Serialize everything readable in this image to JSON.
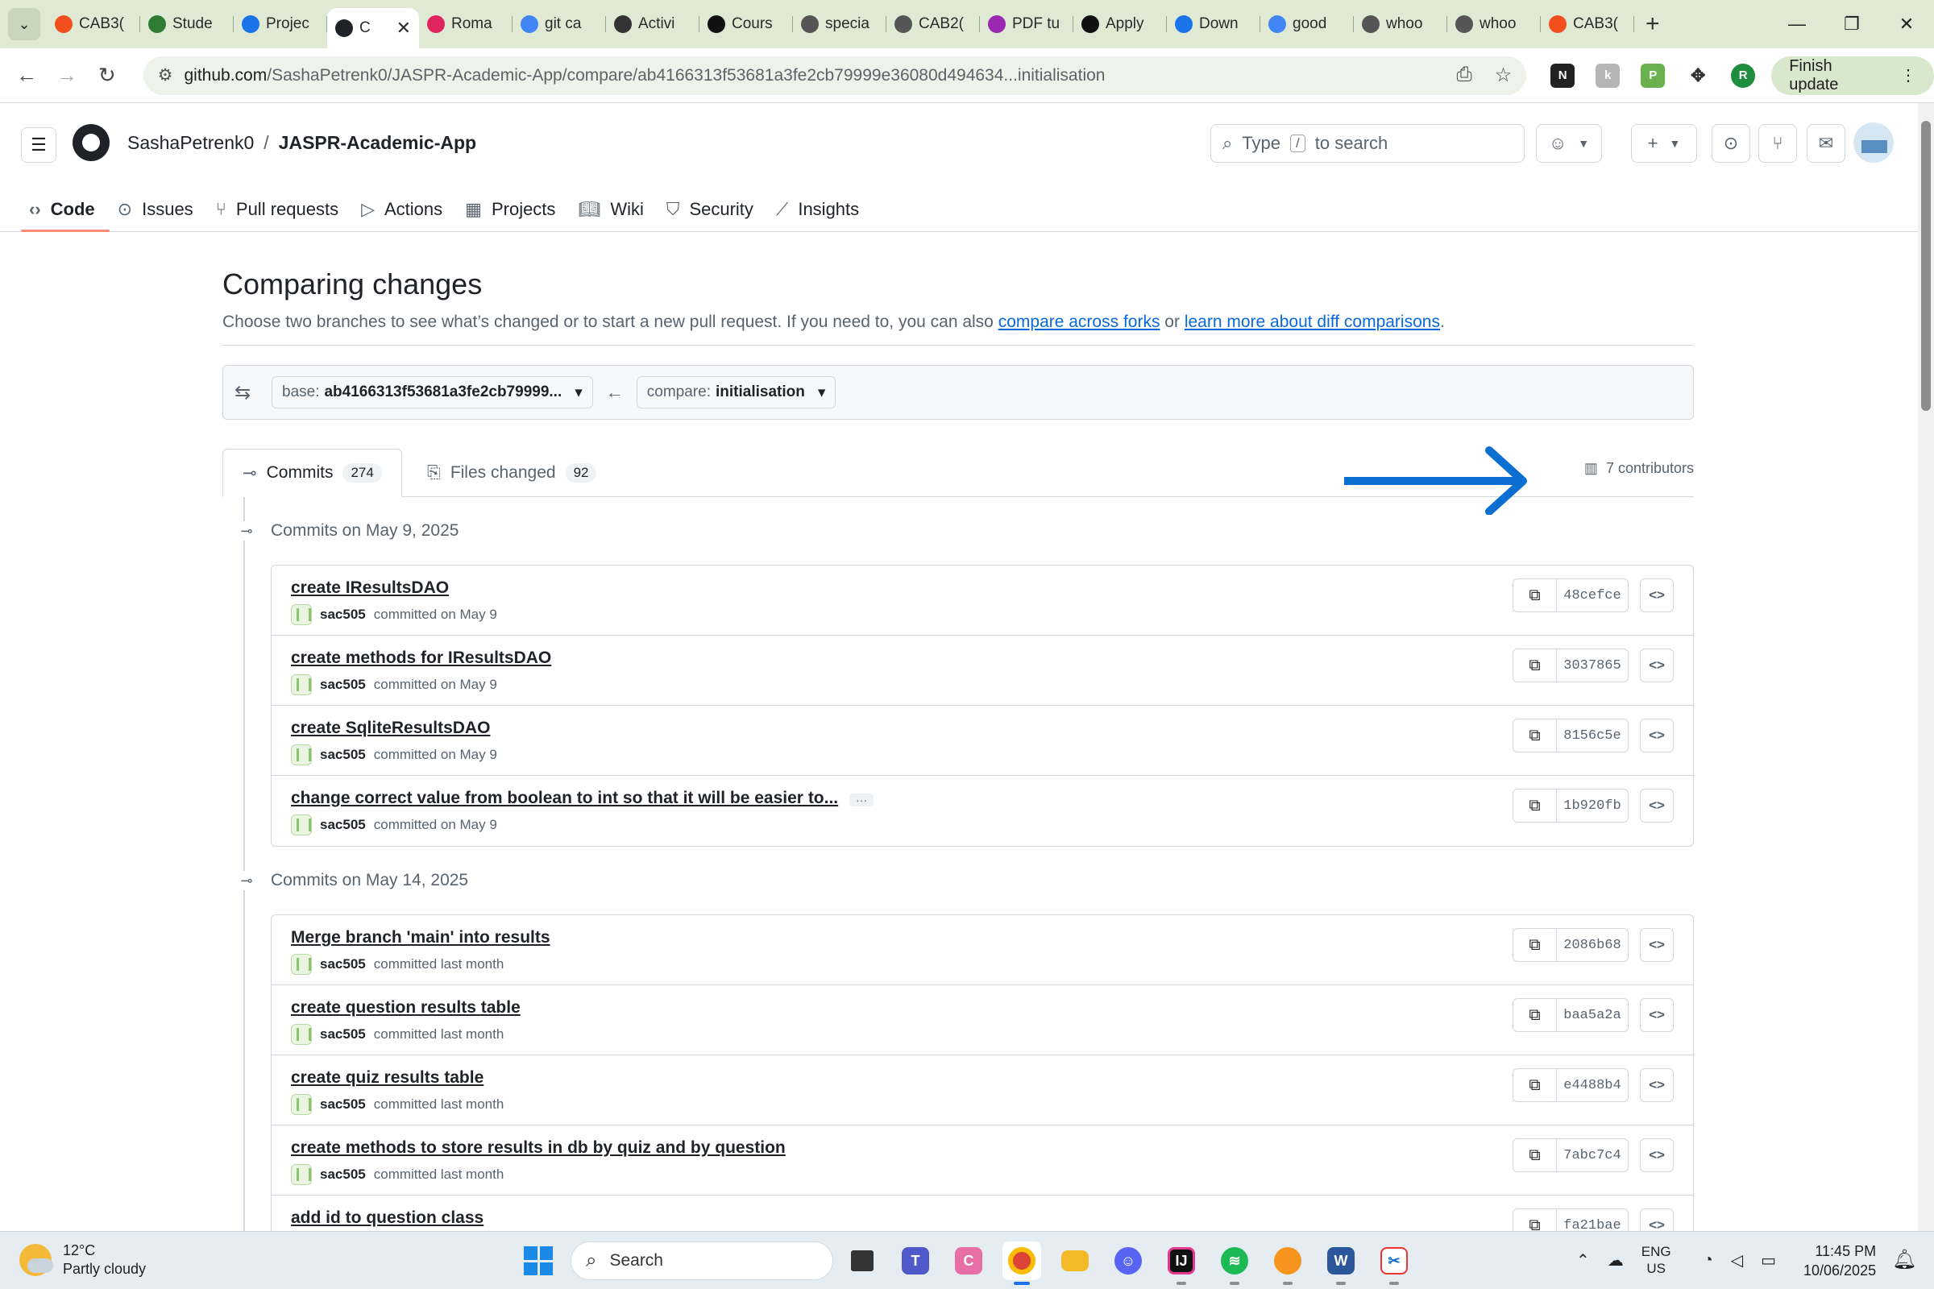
{
  "browser": {
    "tabs": [
      {
        "label": "CAB3(",
        "icon": "figma-icon",
        "color": "#f24e1e"
      },
      {
        "label": "Stude",
        "icon": "lock-icon",
        "color": "#2e7d32"
      },
      {
        "label": "Projec",
        "icon": "search-icon",
        "color": "#1a73e8"
      },
      {
        "label": "C",
        "icon": "github-icon",
        "color": "#1f2328",
        "active": true
      },
      {
        "label": "Roma",
        "icon": "app-icon",
        "color": "#e0245e"
      },
      {
        "label": "git ca",
        "icon": "google-icon",
        "color": "#4285f4"
      },
      {
        "label": "Activi",
        "icon": "qut-icon",
        "color": "#333333"
      },
      {
        "label": "Cours",
        "icon": "qut-icon",
        "color": "#111111"
      },
      {
        "label": "specia",
        "icon": "github-icon",
        "color": "#555555"
      },
      {
        "label": "CAB2(",
        "icon": "github-icon",
        "color": "#555555"
      },
      {
        "label": "PDF tu",
        "icon": "pdf-icon",
        "color": "#9c27b0"
      },
      {
        "label": "Apply",
        "icon": "openai-icon",
        "color": "#111111"
      },
      {
        "label": "Down",
        "icon": "download-icon",
        "color": "#1a73e8"
      },
      {
        "label": "good",
        "icon": "google-icon",
        "color": "#4285f4"
      },
      {
        "label": "whoo",
        "icon": "github-icon",
        "color": "#555555"
      },
      {
        "label": "whoo",
        "icon": "github-icon",
        "color": "#555555"
      },
      {
        "label": "CAB3(",
        "icon": "figma-icon",
        "color": "#f24e1e"
      }
    ],
    "url_host": "github.com",
    "url_path": "/SashaPetrenk0/JASPR-Academic-App/compare/ab4166313f53681a3fe2cb79999e36080d494634...initialisation",
    "finish_update": "Finish update",
    "profile_initial": "R"
  },
  "github": {
    "owner": "SashaPetrenk0",
    "separator": "/",
    "repo": "JASPR-Academic-App",
    "search_prefix": "Type",
    "search_key": "/",
    "search_suffix": "to search",
    "nav": [
      {
        "label": "Code",
        "icon": "code-icon",
        "selected": true
      },
      {
        "label": "Issues",
        "icon": "issue-icon"
      },
      {
        "label": "Pull requests",
        "icon": "pull-request-icon"
      },
      {
        "label": "Actions",
        "icon": "play-icon"
      },
      {
        "label": "Projects",
        "icon": "table-icon"
      },
      {
        "label": "Wiki",
        "icon": "book-icon"
      },
      {
        "label": "Security",
        "icon": "shield-icon"
      },
      {
        "label": "Insights",
        "icon": "graph-icon"
      }
    ]
  },
  "compare": {
    "title": "Comparing changes",
    "desc_prefix": "Choose two branches to see what’s changed or to start a new pull request. If you need to, you can also",
    "link1": "compare across forks",
    "desc_mid": "or",
    "link2": "learn more about diff comparisons",
    "desc_end": ".",
    "base_label": "base:",
    "base_value": "ab4166313f53681a3fe2cb79999...",
    "compare_label": "compare:",
    "compare_value": "initialisation",
    "commits_tab": "Commits",
    "commits_count": "274",
    "files_tab": "Files changed",
    "files_count": "92",
    "contributors": "7 contributors"
  },
  "commit_groups": [
    {
      "date": "Commits on May 9, 2025",
      "commits": [
        {
          "title": "create IResultsDAO",
          "author": "sac505",
          "when": "committed on May 9",
          "sha": "48cefce"
        },
        {
          "title": "create methods for IResultsDAO",
          "author": "sac505",
          "when": "committed on May 9",
          "sha": "3037865"
        },
        {
          "title": "create SqliteResultsDAO",
          "author": "sac505",
          "when": "committed on May 9",
          "sha": "8156c5e"
        },
        {
          "title": "change correct value from boolean to int so that it will be easier to...",
          "author": "sac505",
          "when": "committed on May 9",
          "sha": "1b920fb",
          "ellipsis": "···"
        }
      ]
    },
    {
      "date": "Commits on May 14, 2025",
      "commits": [
        {
          "title": "Merge branch 'main' into results",
          "author": "sac505",
          "when": "committed last month",
          "sha": "2086b68"
        },
        {
          "title": "create question results table",
          "author": "sac505",
          "when": "committed last month",
          "sha": "baa5a2a"
        },
        {
          "title": "create quiz results table",
          "author": "sac505",
          "when": "committed last month",
          "sha": "e4488b4"
        },
        {
          "title": "create methods to store results in db by quiz and by question",
          "author": "sac505",
          "when": "committed last month",
          "sha": "7abc7c4"
        },
        {
          "title": "add id to question class",
          "author": "sac505",
          "when": "committed last month",
          "sha": "fa21bae"
        }
      ]
    }
  ],
  "taskbar": {
    "temp": "12°C",
    "weather": "Partly cloudy",
    "search": "Search",
    "lang1": "ENG",
    "lang2": "US",
    "time": "11:45 PM",
    "date": "10/06/2025"
  },
  "colors": {
    "accent": "#0969da",
    "selected_tab_underline": "#fd8c73",
    "annotation_arrow": "#0a6fd0"
  }
}
